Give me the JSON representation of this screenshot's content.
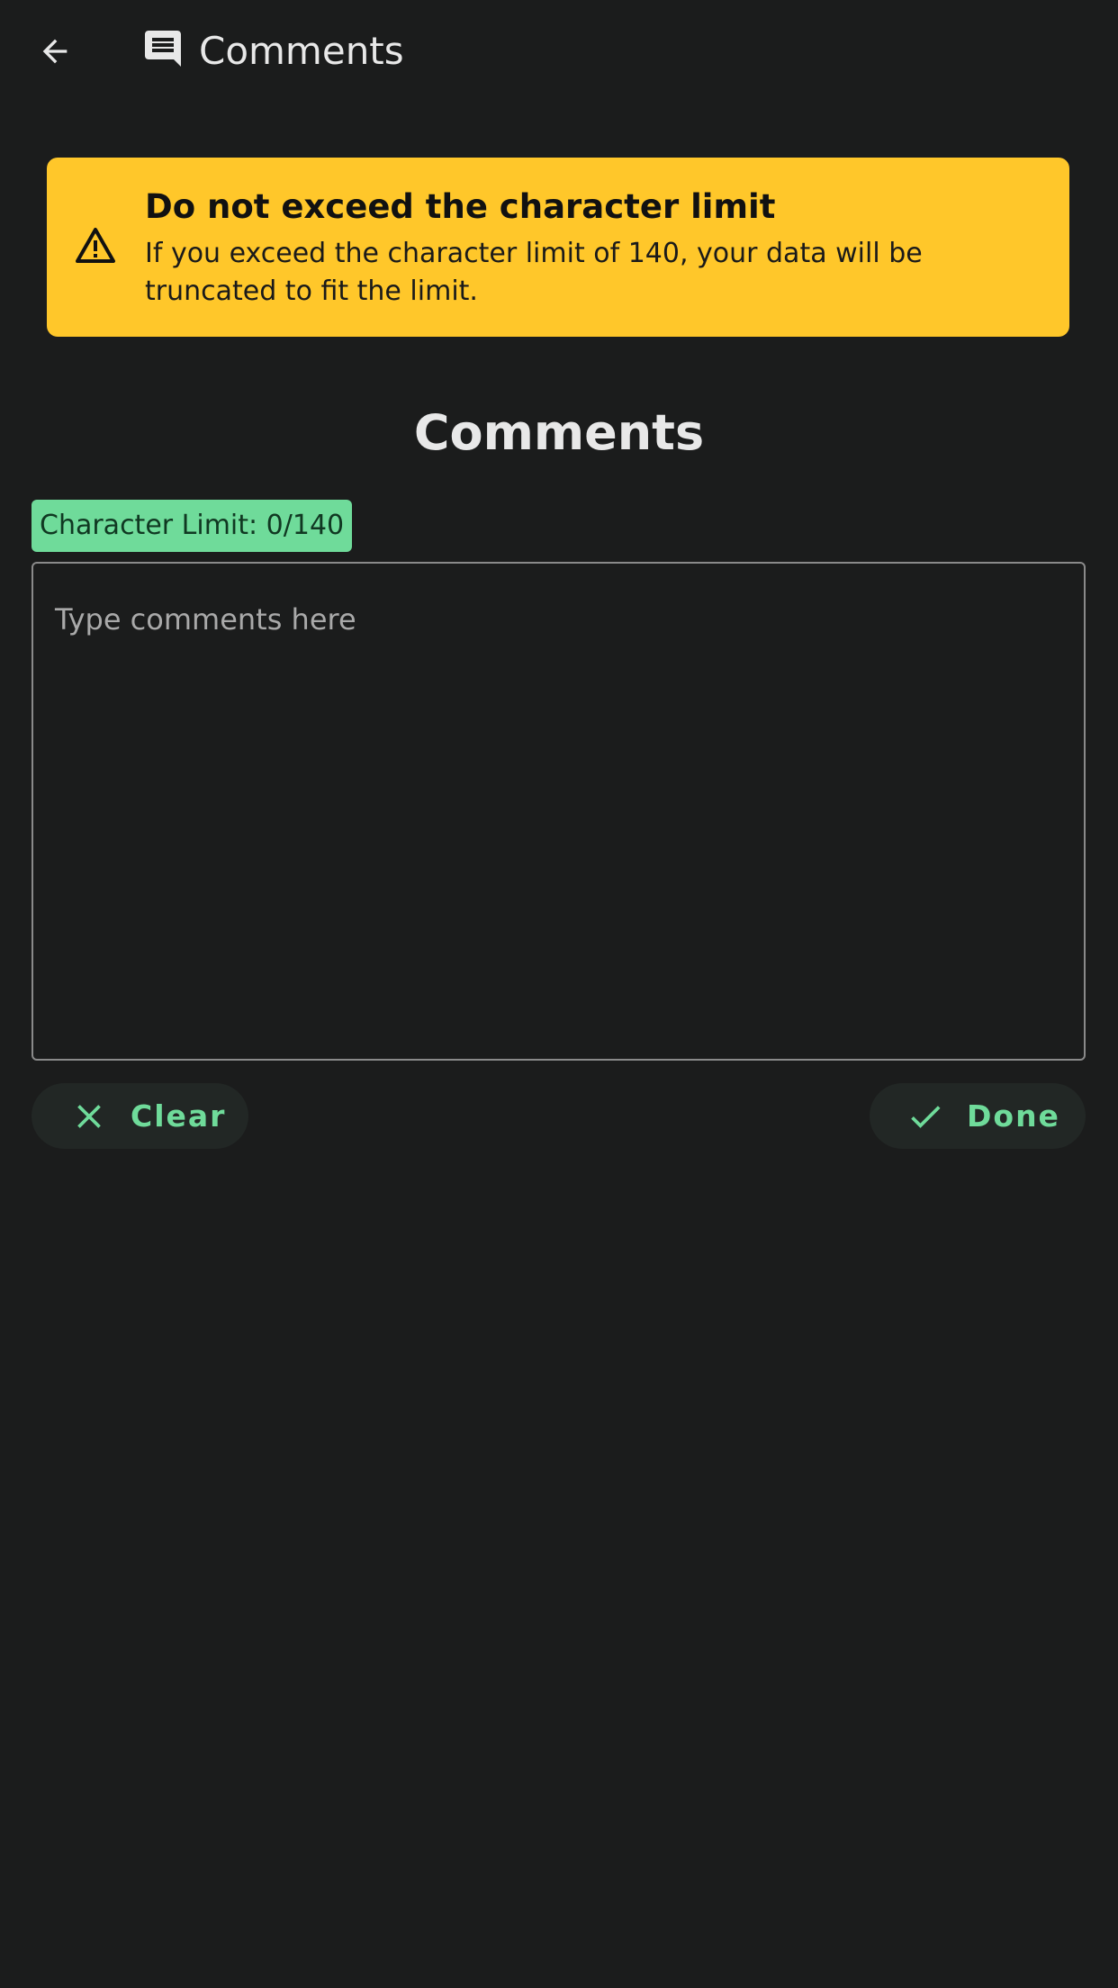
{
  "appbar": {
    "title": "Comments",
    "back_icon": "arrow-left-icon",
    "title_icon": "comment-icon"
  },
  "banner": {
    "icon": "warning-icon",
    "title": "Do not exceed the character limit",
    "text": "If you exceed the character limit of 140, your data will be truncated to fit the limit.",
    "color": "#ffc72a"
  },
  "section": {
    "heading": "Comments"
  },
  "char_limit": {
    "label": "Character Limit: 0/140",
    "color": "#6fdb9a"
  },
  "comment_input": {
    "value": "",
    "placeholder": "Type comments here"
  },
  "actions": {
    "clear_label": "Clear",
    "clear_icon": "close-icon",
    "done_label": "Done",
    "done_icon": "check-icon",
    "accent_color": "#6fdb9a"
  },
  "theme": {
    "background": "#1b1c1c"
  }
}
